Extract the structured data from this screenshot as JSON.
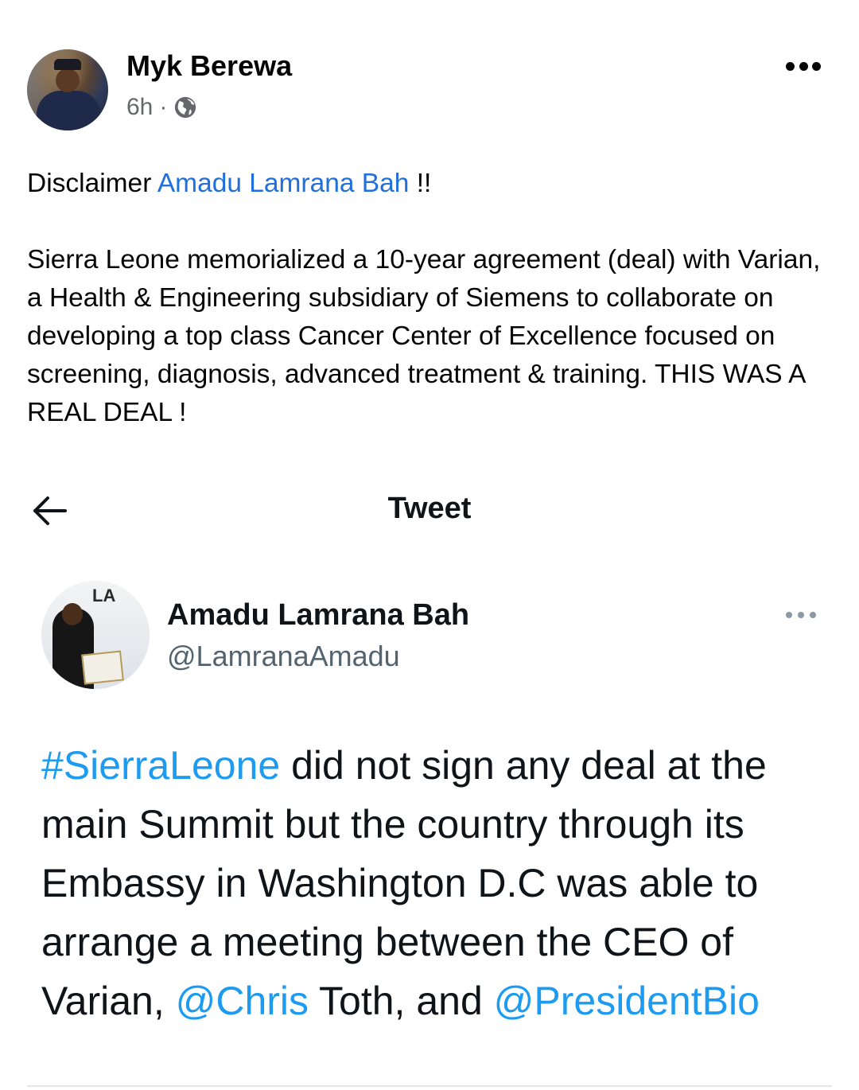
{
  "post": {
    "author_name": "Myk Berewa",
    "time": "6h",
    "separator": "·",
    "privacy_icon": "globe-icon",
    "more_icon": "more-options-icon",
    "text_intro": "Disclaimer ",
    "mention": "Amadu Lamrana Bah",
    "text_exclaim": " !!",
    "body": "Sierra Leone memorialized a 10-year agreement (deal)  with Varian, a Health & Engineering subsidiary of Siemens to collaborate on developing a top class Cancer Center of Excellence focused on screening, diagnosis, advanced treatment & training. THIS WAS A REAL DEAL !"
  },
  "tweet": {
    "back_icon": "back-arrow-icon",
    "title": "Tweet",
    "author_name": "Amadu Lamrana Bah",
    "handle": "@LamranaAmadu",
    "avatar_text": "LA",
    "more_icon": "more-options-icon",
    "hashtag": "#SierraLeone",
    "text_1": " did not sign any deal at the main Summit but the country through its Embassy in Washington D.C was able to arrange a meeting between the CEO of Varian, ",
    "mention_1": "@Chris",
    "text_2": " Toth, and ",
    "mention_2": "@PresidentBio"
  },
  "colors": {
    "fb_link": "#216fdb",
    "tw_link": "#1d9bf0",
    "secondary_text": "#65676b",
    "tw_secondary": "#536471"
  }
}
